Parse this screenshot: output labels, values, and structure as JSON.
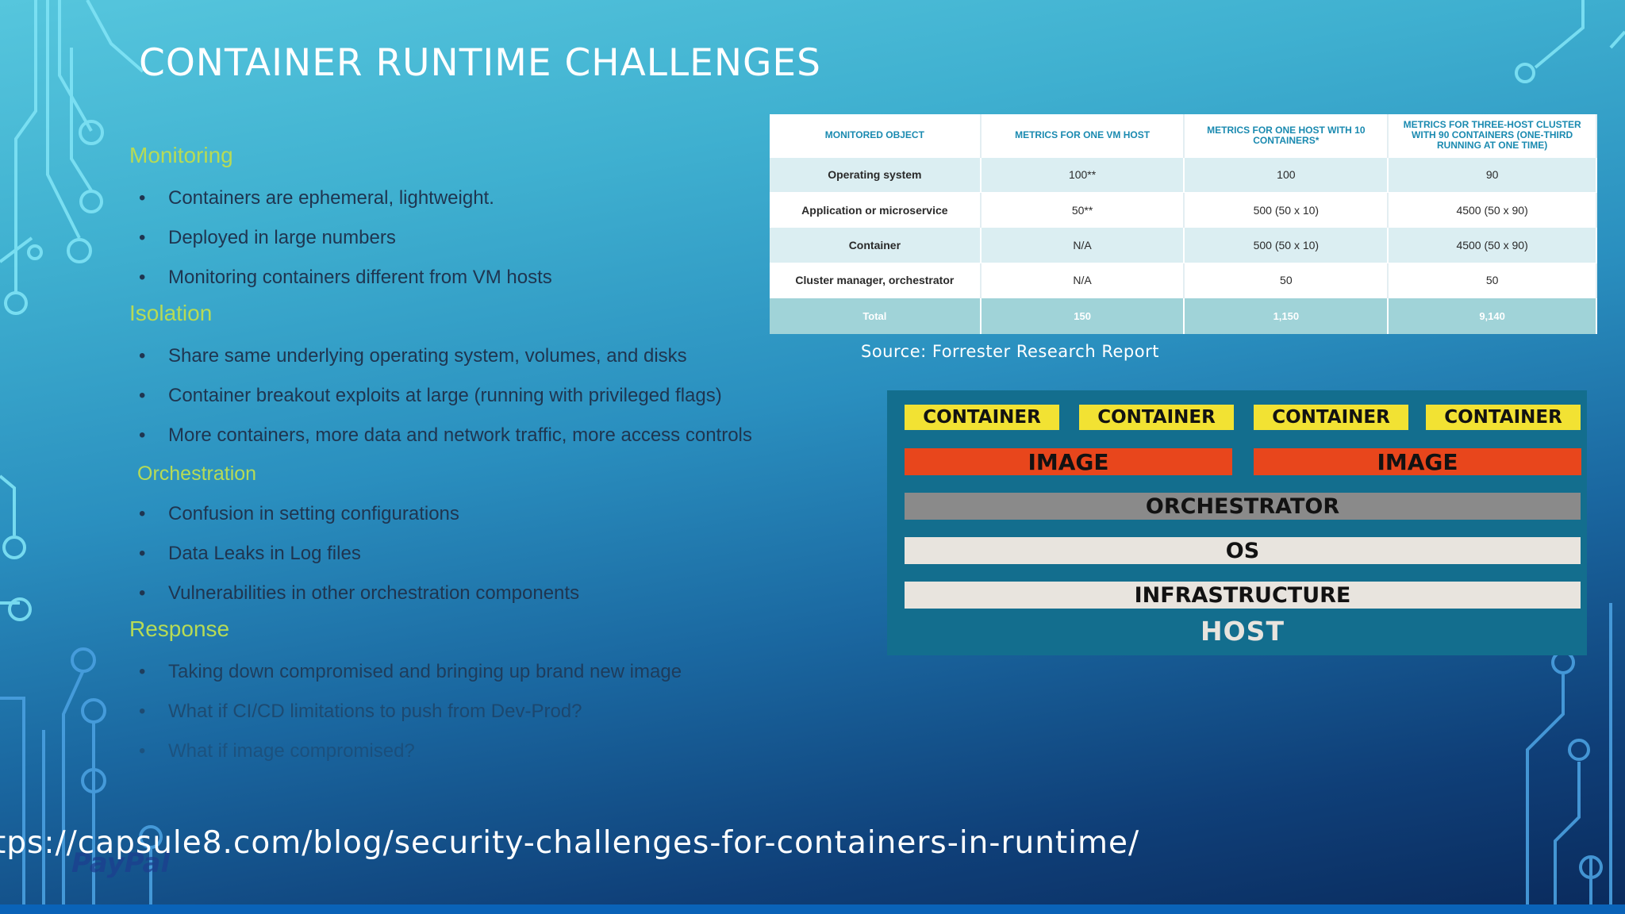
{
  "slide": {
    "title": "CONTAINER RUNTIME CHALLENGES",
    "source": "Source: Forrester Research Report",
    "url": "tps://capsule8.com/blog/security-challenges-for-containers-in-runtime/",
    "watermark": "PayPal"
  },
  "sections": [
    {
      "heading": "Monitoring",
      "bullets": [
        "Containers are ephemeral, lightweight.",
        "Deployed in large numbers",
        "Monitoring containers different from VM hosts"
      ]
    },
    {
      "heading": "Isolation",
      "bullets": [
        "Share same underlying operating system, volumes, and disks",
        "Container breakout exploits at large (running with privileged flags)",
        "More containers, more data and network traffic, more access controls"
      ]
    },
    {
      "heading": "Orchestration",
      "bullets": [
        "Confusion in setting configurations",
        "Data Leaks in Log files",
        "Vulnerabilities in other orchestration components"
      ]
    },
    {
      "heading": "Response",
      "bullets": [
        "Taking down compromised and bringing up brand new image",
        "What if CI/CD limitations to push from Dev-Prod?",
        "What if image compromised?"
      ]
    }
  ],
  "table": {
    "headers": [
      "MONITORED OBJECT",
      "METRICS FOR ONE VM HOST",
      "METRICS FOR ONE HOST WITH 10 CONTAINERS*",
      "METRICS FOR THREE-HOST CLUSTER WITH 90 CONTAINERS (ONE-THIRD RUNNING AT ONE TIME)"
    ],
    "rows": [
      [
        "Operating system",
        "100**",
        "100",
        "90"
      ],
      [
        "Application or microservice",
        "50**",
        "500 (50 x 10)",
        "4500 (50 x 90)"
      ],
      [
        "Container",
        "N/A",
        "500 (50 x 10)",
        "4500 (50 x 90)"
      ],
      [
        "Cluster manager, orchestrator",
        "N/A",
        "50",
        "50"
      ],
      [
        "Total",
        "150",
        "1,150",
        "9,140"
      ]
    ]
  },
  "diagram": {
    "containers": [
      "CONTAINER",
      "CONTAINER",
      "CONTAINER",
      "CONTAINER"
    ],
    "images": [
      "IMAGE",
      "IMAGE"
    ],
    "orchestrator": "ORCHESTRATOR",
    "os": "OS",
    "infrastructure": "INFRASTRUCTURE",
    "host": "HOST"
  },
  "colors": {
    "heading": "#b7db55",
    "container": "#f2e233",
    "image": "#e8461c",
    "orchestrator": "#8a8a8a",
    "diagram_bg": "#136e8e",
    "table_header_text": "#1a8ab0",
    "table_total_row": "#a0d3d8"
  }
}
